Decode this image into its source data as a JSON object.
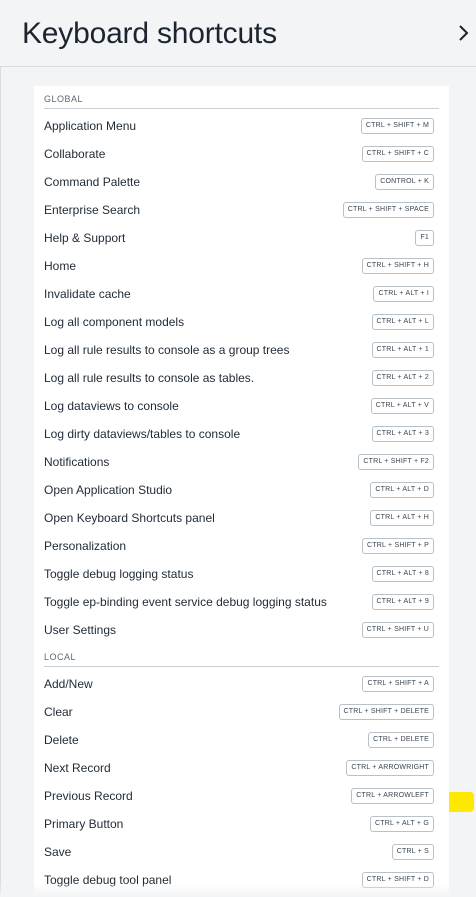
{
  "header": {
    "title": "Keyboard shortcuts"
  },
  "sections": [
    {
      "title": "GLOBAL",
      "items": [
        {
          "label": "Application Menu",
          "keys": "CTRL + SHIFT + M"
        },
        {
          "label": "Collaborate",
          "keys": "CTRL + SHIFT + C"
        },
        {
          "label": "Command Palette",
          "keys": "CONTROL + K"
        },
        {
          "label": "Enterprise Search",
          "keys": "CTRL + SHIFT + SPACE"
        },
        {
          "label": "Help & Support",
          "keys": "F1"
        },
        {
          "label": "Home",
          "keys": "CTRL + SHIFT + H"
        },
        {
          "label": "Invalidate cache",
          "keys": "CTRL + ALT + I"
        },
        {
          "label": "Log all component models",
          "keys": "CTRL + ALT + L"
        },
        {
          "label": "Log all rule results to console as a group trees",
          "keys": "CTRL + ALT + 1"
        },
        {
          "label": "Log all rule results to console as tables.",
          "keys": "CTRL + ALT + 2"
        },
        {
          "label": "Log dataviews to console",
          "keys": "CTRL + ALT + V"
        },
        {
          "label": "Log dirty dataviews/tables to console",
          "keys": "CTRL + ALT + 3"
        },
        {
          "label": "Notifications",
          "keys": "CTRL + SHIFT + F2"
        },
        {
          "label": "Open Application Studio",
          "keys": "CTRL + ALT + D"
        },
        {
          "label": "Open Keyboard Shortcuts panel",
          "keys": "CTRL + ALT + H"
        },
        {
          "label": "Personalization",
          "keys": "CTRL + SHIFT + P"
        },
        {
          "label": "Toggle debug logging status",
          "keys": "CTRL + ALT + 8"
        },
        {
          "label": "Toggle ep-binding event service debug logging status",
          "keys": "CTRL + ALT + 9"
        },
        {
          "label": "User Settings",
          "keys": "CTRL + SHIFT + U"
        }
      ]
    },
    {
      "title": "LOCAL",
      "items": [
        {
          "label": "Add/New",
          "keys": "CTRL + SHIFT + A"
        },
        {
          "label": "Clear",
          "keys": "CTRL + SHIFT + DELETE"
        },
        {
          "label": "Delete",
          "keys": "CTRL + DELETE"
        },
        {
          "label": "Next Record",
          "keys": "CTRL + ARROWRIGHT"
        },
        {
          "label": "Previous Record",
          "keys": "CTRL + ARROWLEFT"
        },
        {
          "label": "Primary Button",
          "keys": "CTRL + ALT + G"
        },
        {
          "label": "Save",
          "keys": "CTRL + S"
        },
        {
          "label": "Toggle debug tool panel",
          "keys": "CTRL + SHIFT + D"
        }
      ]
    }
  ],
  "colors": {
    "highlight": "#fde800",
    "panel_bg": "#f3f4f5",
    "content_bg": "#ffffff"
  }
}
